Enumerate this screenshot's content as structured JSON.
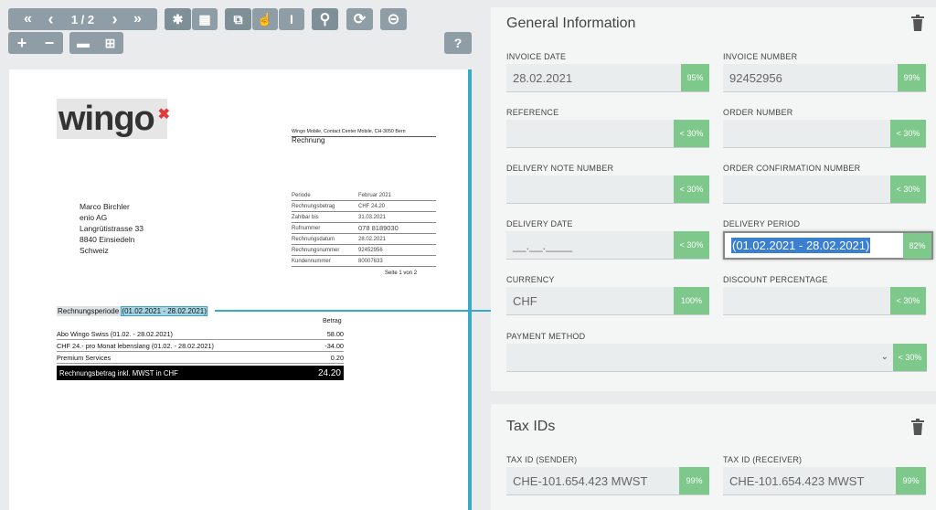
{
  "toolbar": {
    "first": "«",
    "prev": "‹",
    "page": "1 / 2",
    "next": "›",
    "last": "»",
    "asterisk": "✱",
    "grid": "▦",
    "copy": "⧉",
    "hand": "☝",
    "text_cursor": "I",
    "search": "⚲",
    "redo": "⟳",
    "scan": "⊝",
    "plus": "+",
    "minus": "−",
    "ruler": "▬",
    "layout": "⊞",
    "help": "?"
  },
  "document": {
    "logo": "wingo",
    "logo_mark": "✖",
    "sender_line": "Wingo Mobile, Contact Center Mobile, CH-3050 Bern",
    "doc_title": "Rechnung",
    "address": [
      "Marco Birchler",
      "enio AG",
      "Langrütistrasse 33",
      "8840 Einsiedeln",
      "Schweiz"
    ],
    "info_rows": [
      {
        "k": "Periode",
        "v": "Februar 2021"
      },
      {
        "k": "Rechnungsbetrag",
        "v": "CHF 24.20"
      },
      {
        "k": "Zahlbar bis",
        "v": "31.03.2021"
      },
      {
        "k": "Rufnummer",
        "v": "078 8189030"
      },
      {
        "k": "Rechnungsdatum",
        "v": "28.02.2021"
      },
      {
        "k": "Rechnungsnummer",
        "v": "92452956"
      },
      {
        "k": "Kundennummer",
        "v": "80007633"
      }
    ],
    "page_info": "Seite 1 von 2",
    "period_label": "Rechnungsperiode",
    "period_value": "(01.02.2021 - 28.02.2021)",
    "amount_header": "Betrag",
    "lines": [
      {
        "label": "Abo Wingo Swiss (01.02. - 28.02.2021)",
        "amount": "58.00"
      },
      {
        "label": "CHF 24.- pro Monat lebenslang (01.02. - 28.02.2021)",
        "amount": "-34.00"
      },
      {
        "label": "Premium Services",
        "amount": "0.20"
      }
    ],
    "total_label": "Rechnungsbetrag inkl. MWST in CHF",
    "total_amount": "24.20"
  },
  "general": {
    "title": "General Information",
    "invoice_date": {
      "label": "INVOICE DATE",
      "value": "28.02.2021",
      "badge": "95%"
    },
    "invoice_number": {
      "label": "INVOICE NUMBER",
      "value": "92452956",
      "badge": "99%"
    },
    "reference": {
      "label": "REFERENCE",
      "value": "",
      "badge": "< 30%"
    },
    "order_number": {
      "label": "ORDER NUMBER",
      "value": "",
      "badge": "< 30%"
    },
    "delivery_note": {
      "label": "DELIVERY NOTE NUMBER",
      "value": "",
      "badge": "< 30%"
    },
    "order_confirmation": {
      "label": "ORDER CONFIRMATION NUMBER",
      "value": "",
      "badge": "< 30%"
    },
    "delivery_date": {
      "label": "DELIVERY DATE",
      "value": "__.__.____",
      "badge": "< 30%"
    },
    "delivery_period": {
      "label": "DELIVERY PERIOD",
      "value": "(01.02.2021 - 28.02.2021)",
      "badge": "82%"
    },
    "currency": {
      "label": "CURRENCY",
      "value": "CHF",
      "badge": "100%"
    },
    "discount": {
      "label": "DISCOUNT PERCENTAGE",
      "value": "",
      "badge": "< 30%"
    },
    "payment_method": {
      "label": "PAYMENT METHOD",
      "value": "",
      "badge": "< 30%"
    }
  },
  "tax": {
    "title": "Tax IDs",
    "sender": {
      "label": "TAX ID (SENDER)",
      "value": "CHE-101.654.423 MWST",
      "badge": "99%"
    },
    "receiver": {
      "label": "TAX ID (RECEIVER)",
      "value": "CHE-101.654.423 MWST",
      "badge": "99%"
    }
  },
  "colors": {
    "badge": "#7dc88a",
    "toolbar": "#8f9ea6",
    "highlight": "#3aa9c6",
    "selection": "#3a7fd0"
  }
}
